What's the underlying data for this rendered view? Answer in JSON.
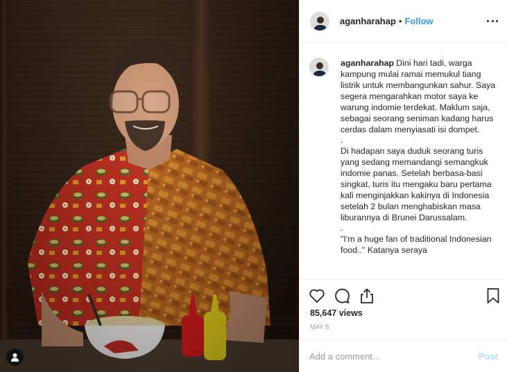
{
  "post": {
    "username": "aganharahap",
    "follow_label": "Follow",
    "separator": "•",
    "caption_username": "aganharahap",
    "caption_paragraphs": [
      "Dini hari tadi, warga kampung mulai ramai memukul tiang listrik untuk membangunkan sahur. Saya segera mengarahkan motor saya ke warung indomie terdekat. Maklum saja, sebagai seorang seniman kadang harus cerdas dalam menyiasati isi dompet.",
      ".",
      "Di hadapan saya duduk seorang turis yang sedang memandangi semangkuk indomie panas. Setelah berbasa-basi singkat, turis itu mengaku baru pertama kali menginjakkan kakinya di Indonesia setelah 2 bulan menghabiskan masa liburannya di Brunei Darussalam.",
      ".",
      "\"I'm a huge fan of traditional Indonesian food..\" Katanya seraya"
    ],
    "views_label": "85,647 views",
    "date_label": "MAY 8",
    "comment_placeholder": "Add a comment...",
    "post_label": "Post"
  },
  "icons": {
    "more": "more-options-icon",
    "like": "heart-icon",
    "comment": "comment-icon",
    "share": "share-icon",
    "save": "bookmark-icon",
    "user_tag": "user-tag-icon"
  },
  "colors": {
    "accent": "#3897f0",
    "post_disabled": "#b2dffc",
    "muted": "#999999",
    "text": "#262626",
    "divider": "#efefef"
  }
}
